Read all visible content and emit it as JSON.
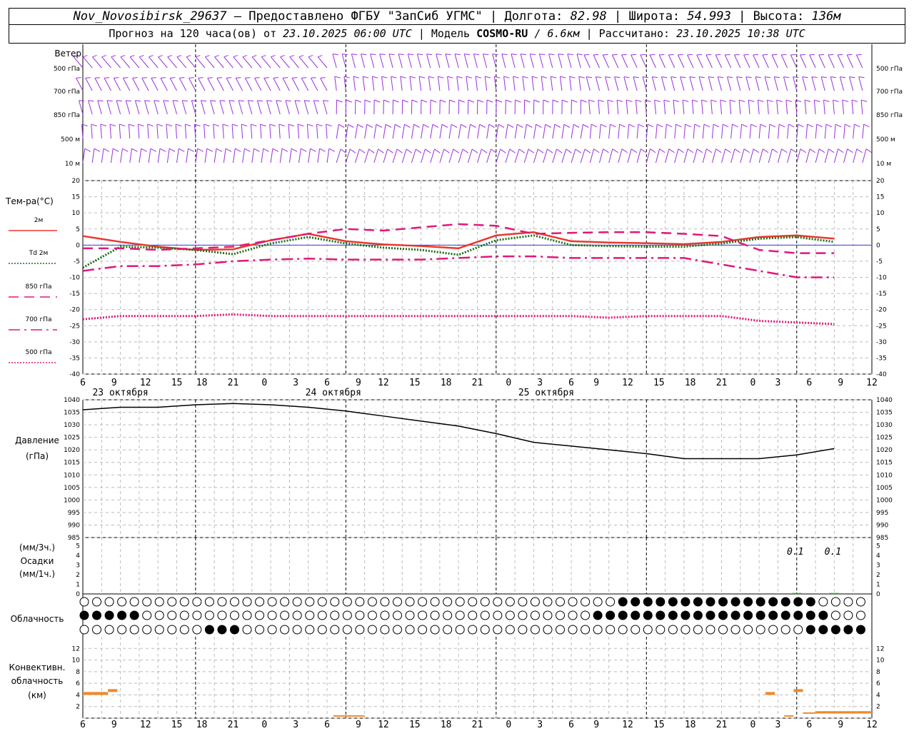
{
  "header": {
    "station": "Nov_Novosibirsk_29637",
    "provider": "– Предоставлено ФГБУ \"ЗапСиб УГМС\"",
    "lon_label": "| Долгота:",
    "lon": "82.98",
    "lat_label": "| Широта:",
    "lat": "54.993",
    "alt_label": "| Высота:",
    "alt": "136м",
    "fc_label": "Прогноз на 120 часа(ов) от",
    "fc_from": "23.10.2025 06:00 UTC",
    "model_label": "| Модель",
    "model": "COSMO-RU",
    "model_res": "/ 6.6км",
    "calc_label": "| Рассчитано:",
    "calc": "23.10.2025 10:38 UTC"
  },
  "panels": {
    "wind": {
      "title": "Ветер",
      "levels": [
        "500 гПа",
        "700 гПа",
        "850 гПа",
        "500 м",
        "10 м"
      ],
      "right_levels": [
        "500 гПа",
        "700 гПа",
        "850 гПа",
        "500 м",
        "10 м"
      ]
    },
    "temp": {
      "title": "Тем-ра(°C)",
      "legend": [
        "2м",
        "Td  2м",
        "850 гПа",
        "700 гПа",
        "500 гПа"
      ]
    },
    "pressure": {
      "title_1": "Давление",
      "title_2": "(гПа)"
    },
    "precip": {
      "title_1": "(мм/3ч.)",
      "title_2": "Осадки",
      "title_3": "(мм/1ч.)",
      "labels": [
        "0.1",
        "0.1"
      ]
    },
    "cloud": {
      "title": "Облачность"
    },
    "conv": {
      "title_1": "Конвективн.",
      "title_2": "облачность",
      "title_3": "(км)"
    }
  },
  "x_axis": {
    "hour_labels": [
      "6",
      "9",
      "12",
      "15",
      "18",
      "21",
      "0",
      "3",
      "6",
      "9",
      "12",
      "15",
      "18",
      "21",
      "0",
      "3",
      "6",
      "9",
      "12",
      "15",
      "18",
      "21",
      "0",
      "3",
      "6",
      "9",
      "12"
    ],
    "day_labels": [
      "23 октября",
      "24 октября",
      "25 октября"
    ]
  },
  "colors": {
    "t2m": "#e8392c",
    "td": "#1a6e1a",
    "t850": "#e0187a",
    "t700": "#e0187a",
    "t500": "#e0187a",
    "wind": "#9a2fe0",
    "pressure": "#000000",
    "precip": "#22b422",
    "conv": "#ef8a2a",
    "zero_line": "#3a3adc"
  },
  "chart_data": [
    {
      "type": "line",
      "title": "Тем-ра(°C)",
      "x_hours": [
        0,
        6,
        12,
        18,
        24,
        30,
        36,
        42,
        48,
        54,
        60,
        66,
        72,
        78,
        84,
        90,
        96,
        102,
        108,
        114,
        120
      ],
      "ylim": [
        -40,
        20
      ],
      "yticks": [
        20,
        15,
        10,
        5,
        0,
        -5,
        -10,
        -15,
        -20,
        -25,
        -30,
        -35,
        -40
      ],
      "series": [
        {
          "name": "2м",
          "style": "solid",
          "values": [
            2.8,
            1,
            -0.5,
            -1.5,
            -1.3,
            1.5,
            3.5,
            1.2,
            0.2,
            -0.3,
            -1,
            3,
            4,
            1.2,
            0.8,
            0.6,
            0.3,
            1,
            2.5,
            3,
            2
          ]
        },
        {
          "name": "Td  2м",
          "style": "dotted",
          "values": [
            -7,
            -0.5,
            -0.8,
            -1.5,
            -2.8,
            0.5,
            2.5,
            0.5,
            -0.8,
            -1.5,
            -3,
            1.5,
            3,
            0,
            -0.3,
            -0.5,
            -0.5,
            0.5,
            2,
            2.5,
            1
          ]
        },
        {
          "name": "850 гПа",
          "style": "dashed",
          "values": [
            -1,
            -1,
            -1.5,
            -1,
            -0.5,
            1.5,
            3.5,
            5,
            4.5,
            5.5,
            6.5,
            6,
            3.5,
            3.8,
            4,
            4,
            3.5,
            2.8,
            -1.5,
            -2.5,
            -2.5
          ]
        },
        {
          "name": "700 гПа",
          "style": "dashdot",
          "values": [
            -8,
            -6.5,
            -6.5,
            -6,
            -5,
            -4.5,
            -4.2,
            -4.5,
            -4.5,
            -4.5,
            -4,
            -3.5,
            -3.5,
            -4,
            -4,
            -4,
            -4,
            -6,
            -8,
            -10,
            -10
          ]
        },
        {
          "name": "500 гПа",
          "style": "dotted-fine",
          "values": [
            -23,
            -22,
            -22,
            -22,
            -21.5,
            -22,
            -22,
            -22,
            -22,
            -22,
            -22,
            -22,
            -22,
            -22,
            -22.5,
            -22,
            -22,
            -22,
            -23.5,
            -24,
            -24.5
          ]
        }
      ]
    },
    {
      "type": "line",
      "title": "Давление",
      "ylabel": "(гПа)",
      "ylim": [
        985,
        1040
      ],
      "yticks": [
        1040,
        1035,
        1030,
        1025,
        1020,
        1015,
        1010,
        1005,
        1000,
        995,
        990,
        985
      ],
      "x_hours": [
        0,
        6,
        12,
        18,
        24,
        30,
        36,
        42,
        48,
        54,
        60,
        66,
        72,
        78,
        84,
        90,
        96,
        102,
        108,
        114,
        120
      ],
      "series": [
        {
          "name": "Давление",
          "values": [
            1036,
            1037,
            1037,
            1038,
            1038.5,
            1038,
            1037,
            1035.5,
            1033.5,
            1031.5,
            1029.5,
            1026.5,
            1023,
            1021.5,
            1020,
            1018.5,
            1016.5,
            1016.5,
            1016.5,
            1018,
            1020.5
          ]
        }
      ]
    },
    {
      "type": "bar",
      "title": "Осадки",
      "ylim": [
        0,
        5
      ],
      "yticks": [
        5,
        4,
        3,
        2,
        1,
        0
      ],
      "x_hours": [
        114,
        120
      ],
      "values": [
        0.1,
        0.1
      ]
    },
    {
      "type": "bar",
      "title": "Конвективн. облачность",
      "ylim": [
        0,
        14
      ],
      "yticks": [
        12,
        10,
        8,
        6,
        4,
        2,
        0
      ],
      "segments": [
        {
          "x0": 0,
          "x1": 4,
          "y0": 4,
          "y1": 4.5
        },
        {
          "x0": 4,
          "x1": 5.5,
          "y0": 4.5,
          "y1": 5
        },
        {
          "x0": 40,
          "x1": 45,
          "y0": 0.3,
          "y1": 0.5
        },
        {
          "x0": 109,
          "x1": 110.5,
          "y0": 4,
          "y1": 4.5
        },
        {
          "x0": 112,
          "x1": 113.5,
          "y0": 0.3,
          "y1": 0.5
        },
        {
          "x0": 113.5,
          "x1": 115,
          "y0": 4.5,
          "y1": 5
        },
        {
          "x0": 115,
          "x1": 117,
          "y0": 0.8,
          "y1": 1
        },
        {
          "x0": 117,
          "x1": 126,
          "y0": 0.8,
          "y1": 1.2
        }
      ]
    }
  ]
}
